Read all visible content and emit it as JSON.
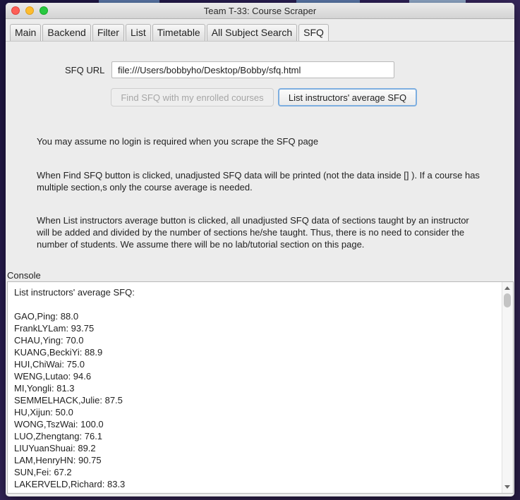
{
  "window": {
    "title": "Team T-33: Course Scraper"
  },
  "tabs": [
    {
      "label": "Main"
    },
    {
      "label": "Backend"
    },
    {
      "label": "Filter"
    },
    {
      "label": "List"
    },
    {
      "label": "Timetable"
    },
    {
      "label": "All Subject Search"
    },
    {
      "label": "SFQ",
      "active": true
    }
  ],
  "sfq": {
    "url_label": "SFQ URL",
    "url_value": "file:///Users/bobbyho/Desktop/Bobby/sfq.html",
    "find_button": "Find SFQ with my enrolled courses",
    "list_button": "List instructors' average SFQ"
  },
  "notes": {
    "p1": "You may assume no login is required when you scrape the SFQ page",
    "p2": "When Find SFQ button is clicked, unadjusted SFQ data will be printed (not the data inside [] ). If a course has multiple section,s only the course average is needed.",
    "p3": "When List instructors average button is clicked, all unadjusted SFQ data of sections taught by an instructor will be added and divided by the number of sections he/she taught. Thus, there is no need to consider the number of students. We assume there will be no lab/tutorial section on this page."
  },
  "console": {
    "label": "Console",
    "text": "List instructors' average SFQ:\n\nGAO,Ping: 88.0\nFrankLYLam: 93.75\nCHAU,Ying: 70.0\nKUANG,BeckiYi: 88.9\nHUI,ChiWai: 75.0\nWENG,Lutao: 94.6\nMI,Yongli: 81.3\nSEMMELHACK,Julie: 87.5\nHU,Xijun: 50.0\nWONG,TszWai: 100.0\nLUO,Zhengtang: 76.1\nLIUYuanShuai: 89.2\nLAM,HenryHN: 90.75\nSUN,Fei: 67.2\nLAKERVELD,Richard: 83.3"
  },
  "colors": {
    "focus_ring": "#7daee0",
    "close": "#fd5f57",
    "minimize": "#fdbc2e",
    "maximize": "#28c840"
  }
}
